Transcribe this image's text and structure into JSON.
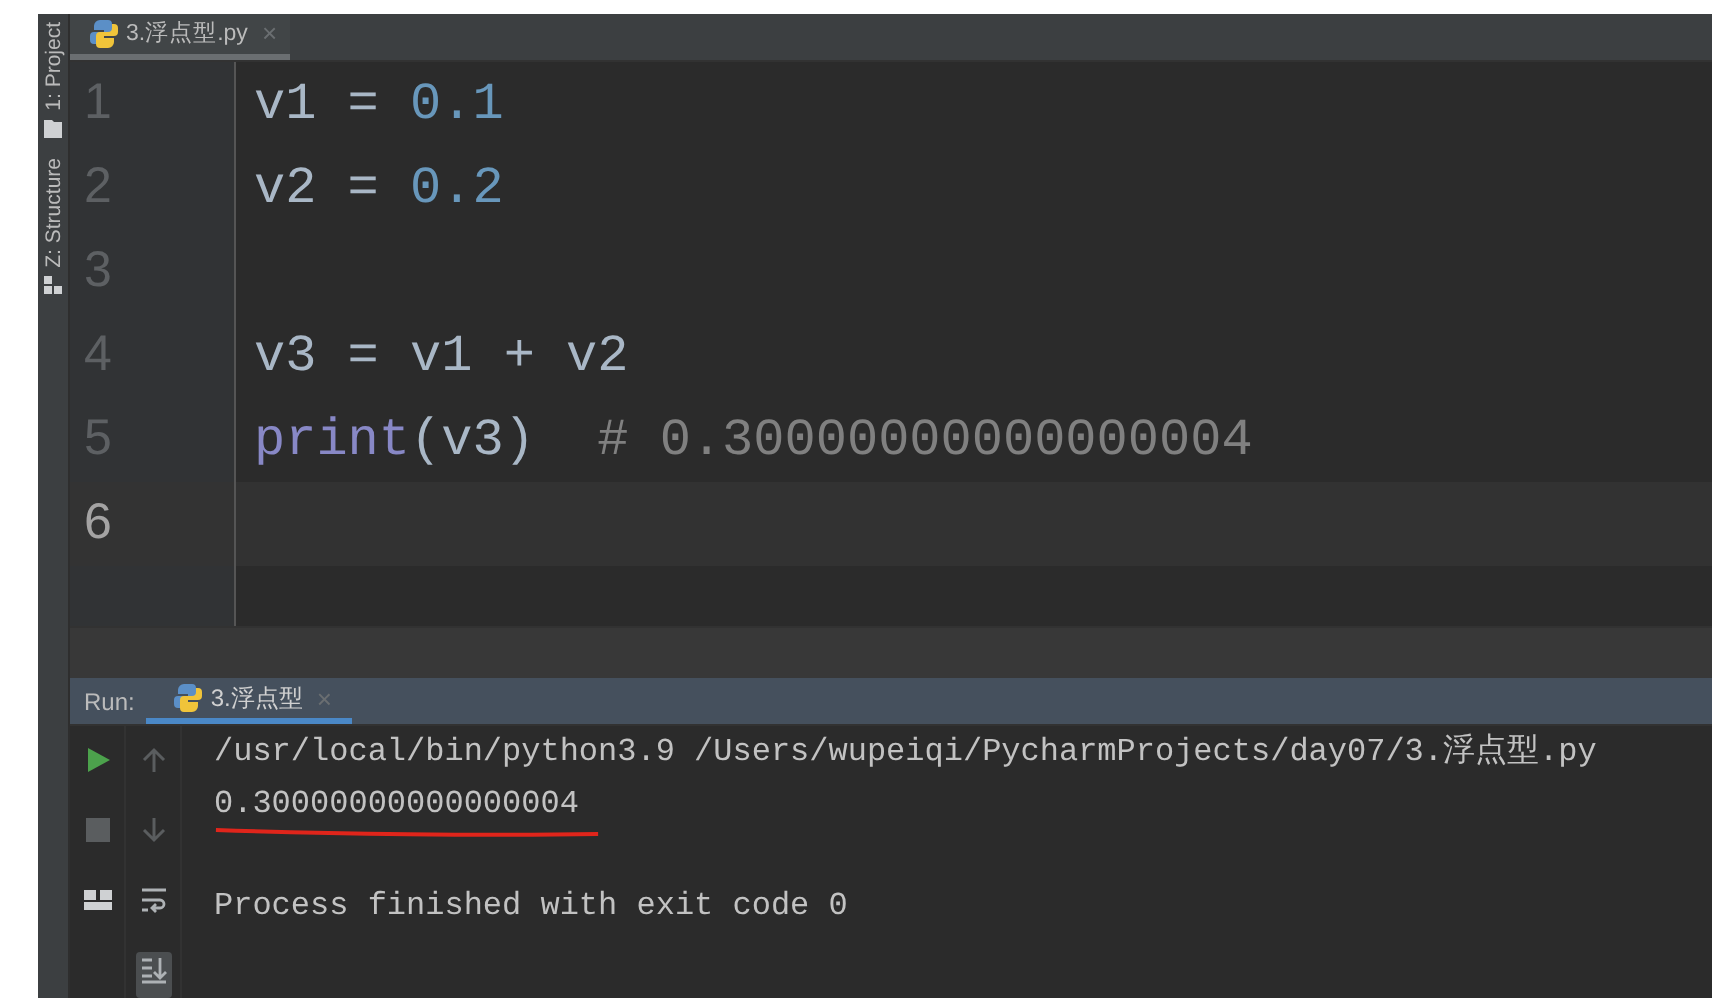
{
  "side_tools": [
    {
      "kind": "project",
      "label": "1: Project"
    },
    {
      "kind": "structure",
      "label": "Z: Structure"
    }
  ],
  "editor_tabs": [
    {
      "label": "3.浮点型.py",
      "selected": true,
      "close": "×"
    }
  ],
  "code_lines": [
    {
      "number": "1",
      "current": false,
      "tokens": [
        {
          "kind": "name",
          "text": "v1 = "
        },
        {
          "kind": "number",
          "text": "0.1"
        }
      ]
    },
    {
      "number": "2",
      "current": false,
      "tokens": [
        {
          "kind": "name",
          "text": "v2 = "
        },
        {
          "kind": "number",
          "text": "0.2"
        }
      ]
    },
    {
      "number": "3",
      "current": false
    },
    {
      "number": "4",
      "current": false,
      "tokens": [
        {
          "kind": "name",
          "text": "v3 = v1 + v2"
        }
      ]
    },
    {
      "number": "5",
      "current": false,
      "tokens": [
        {
          "kind": "builtin",
          "text": "print"
        },
        {
          "kind": "name",
          "text": "(v3)  "
        },
        {
          "kind": "comment",
          "text": "# 0.30000000000000004"
        }
      ]
    },
    {
      "number": "6",
      "current": true
    }
  ],
  "run_panel": {
    "label": "Run:",
    "tabs": [
      {
        "label": "3.浮点型",
        "selected": true,
        "close": "×"
      }
    ],
    "output": [
      {
        "kind": "line",
        "text": "/usr/local/bin/python3.9 /Users/wupeiqi/PycharmProjects/day07/3.浮点型.py",
        "underlined": false
      },
      {
        "kind": "line",
        "text": "0.30000000000000004",
        "underlined": true
      },
      {
        "kind": "blank"
      },
      {
        "kind": "line",
        "text": "Process finished with exit code 0",
        "underlined": false
      }
    ]
  }
}
